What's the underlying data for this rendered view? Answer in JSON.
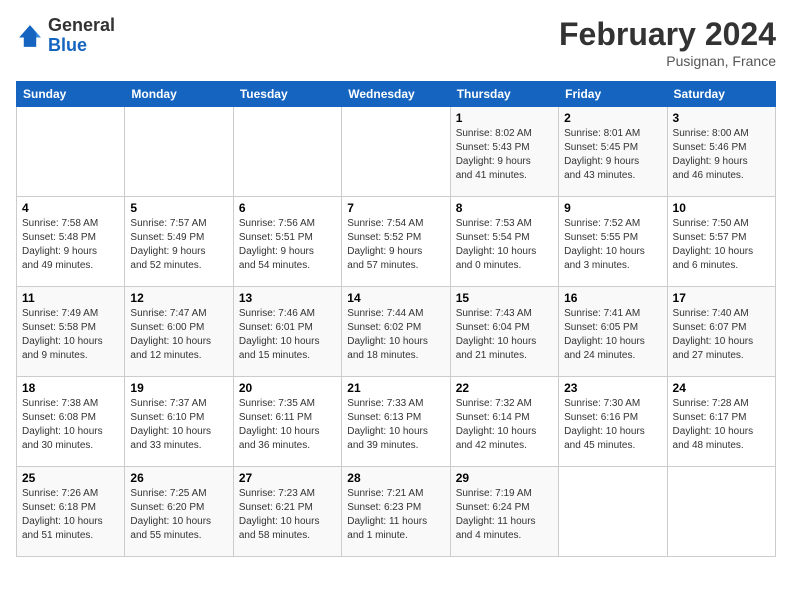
{
  "header": {
    "logo_general": "General",
    "logo_blue": "Blue",
    "title": "February 2024",
    "subtitle": "Pusignan, France"
  },
  "days_of_week": [
    "Sunday",
    "Monday",
    "Tuesday",
    "Wednesday",
    "Thursday",
    "Friday",
    "Saturday"
  ],
  "weeks": [
    [
      {
        "day": "",
        "info": ""
      },
      {
        "day": "",
        "info": ""
      },
      {
        "day": "",
        "info": ""
      },
      {
        "day": "",
        "info": ""
      },
      {
        "day": "1",
        "info": "Sunrise: 8:02 AM\nSunset: 5:43 PM\nDaylight: 9 hours\nand 41 minutes."
      },
      {
        "day": "2",
        "info": "Sunrise: 8:01 AM\nSunset: 5:45 PM\nDaylight: 9 hours\nand 43 minutes."
      },
      {
        "day": "3",
        "info": "Sunrise: 8:00 AM\nSunset: 5:46 PM\nDaylight: 9 hours\nand 46 minutes."
      }
    ],
    [
      {
        "day": "4",
        "info": "Sunrise: 7:58 AM\nSunset: 5:48 PM\nDaylight: 9 hours\nand 49 minutes."
      },
      {
        "day": "5",
        "info": "Sunrise: 7:57 AM\nSunset: 5:49 PM\nDaylight: 9 hours\nand 52 minutes."
      },
      {
        "day": "6",
        "info": "Sunrise: 7:56 AM\nSunset: 5:51 PM\nDaylight: 9 hours\nand 54 minutes."
      },
      {
        "day": "7",
        "info": "Sunrise: 7:54 AM\nSunset: 5:52 PM\nDaylight: 9 hours\nand 57 minutes."
      },
      {
        "day": "8",
        "info": "Sunrise: 7:53 AM\nSunset: 5:54 PM\nDaylight: 10 hours\nand 0 minutes."
      },
      {
        "day": "9",
        "info": "Sunrise: 7:52 AM\nSunset: 5:55 PM\nDaylight: 10 hours\nand 3 minutes."
      },
      {
        "day": "10",
        "info": "Sunrise: 7:50 AM\nSunset: 5:57 PM\nDaylight: 10 hours\nand 6 minutes."
      }
    ],
    [
      {
        "day": "11",
        "info": "Sunrise: 7:49 AM\nSunset: 5:58 PM\nDaylight: 10 hours\nand 9 minutes."
      },
      {
        "day": "12",
        "info": "Sunrise: 7:47 AM\nSunset: 6:00 PM\nDaylight: 10 hours\nand 12 minutes."
      },
      {
        "day": "13",
        "info": "Sunrise: 7:46 AM\nSunset: 6:01 PM\nDaylight: 10 hours\nand 15 minutes."
      },
      {
        "day": "14",
        "info": "Sunrise: 7:44 AM\nSunset: 6:02 PM\nDaylight: 10 hours\nand 18 minutes."
      },
      {
        "day": "15",
        "info": "Sunrise: 7:43 AM\nSunset: 6:04 PM\nDaylight: 10 hours\nand 21 minutes."
      },
      {
        "day": "16",
        "info": "Sunrise: 7:41 AM\nSunset: 6:05 PM\nDaylight: 10 hours\nand 24 minutes."
      },
      {
        "day": "17",
        "info": "Sunrise: 7:40 AM\nSunset: 6:07 PM\nDaylight: 10 hours\nand 27 minutes."
      }
    ],
    [
      {
        "day": "18",
        "info": "Sunrise: 7:38 AM\nSunset: 6:08 PM\nDaylight: 10 hours\nand 30 minutes."
      },
      {
        "day": "19",
        "info": "Sunrise: 7:37 AM\nSunset: 6:10 PM\nDaylight: 10 hours\nand 33 minutes."
      },
      {
        "day": "20",
        "info": "Sunrise: 7:35 AM\nSunset: 6:11 PM\nDaylight: 10 hours\nand 36 minutes."
      },
      {
        "day": "21",
        "info": "Sunrise: 7:33 AM\nSunset: 6:13 PM\nDaylight: 10 hours\nand 39 minutes."
      },
      {
        "day": "22",
        "info": "Sunrise: 7:32 AM\nSunset: 6:14 PM\nDaylight: 10 hours\nand 42 minutes."
      },
      {
        "day": "23",
        "info": "Sunrise: 7:30 AM\nSunset: 6:16 PM\nDaylight: 10 hours\nand 45 minutes."
      },
      {
        "day": "24",
        "info": "Sunrise: 7:28 AM\nSunset: 6:17 PM\nDaylight: 10 hours\nand 48 minutes."
      }
    ],
    [
      {
        "day": "25",
        "info": "Sunrise: 7:26 AM\nSunset: 6:18 PM\nDaylight: 10 hours\nand 51 minutes."
      },
      {
        "day": "26",
        "info": "Sunrise: 7:25 AM\nSunset: 6:20 PM\nDaylight: 10 hours\nand 55 minutes."
      },
      {
        "day": "27",
        "info": "Sunrise: 7:23 AM\nSunset: 6:21 PM\nDaylight: 10 hours\nand 58 minutes."
      },
      {
        "day": "28",
        "info": "Sunrise: 7:21 AM\nSunset: 6:23 PM\nDaylight: 11 hours\nand 1 minute."
      },
      {
        "day": "29",
        "info": "Sunrise: 7:19 AM\nSunset: 6:24 PM\nDaylight: 11 hours\nand 4 minutes."
      },
      {
        "day": "",
        "info": ""
      },
      {
        "day": "",
        "info": ""
      }
    ]
  ]
}
